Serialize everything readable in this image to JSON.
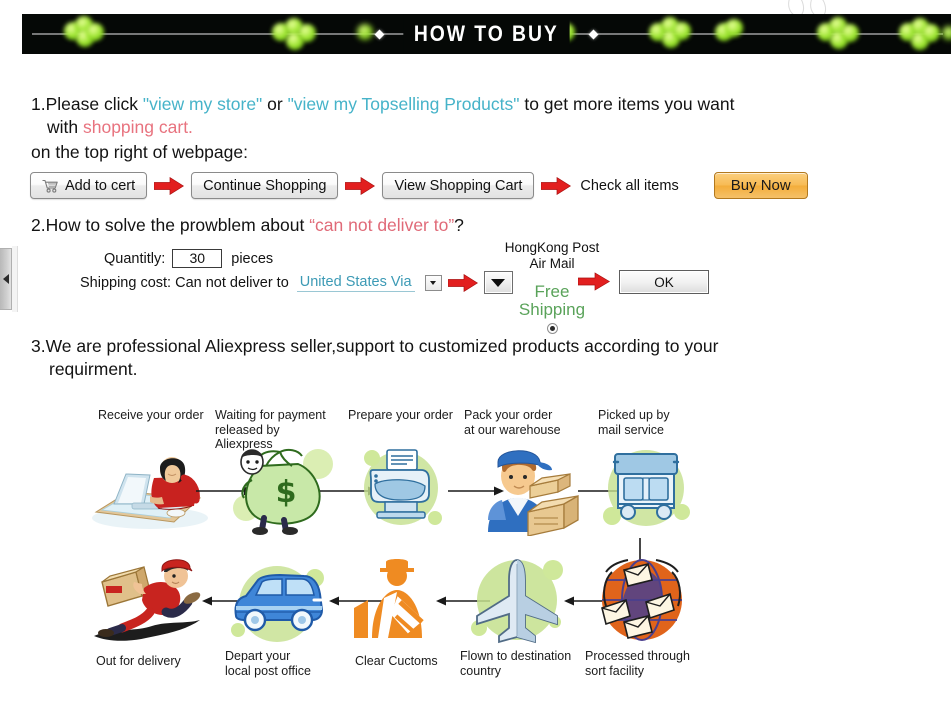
{
  "banner": {
    "title": "HOW TO BUY",
    "bullet_icon": "diamond-bullet",
    "background_color": "#050806",
    "text_color": "#ffffff"
  },
  "watermark": {
    "icon": "faint-watermark-mark"
  },
  "left_tab": {
    "icon": "collapse-left-arrow-icon"
  },
  "section1": {
    "number": "1.",
    "line1_a": "Please click ",
    "link1": "\"view my store\"",
    "line1_b": " or ",
    "link2": "\"view my Topselling Products\"",
    "line1_c": " to get more items you want",
    "line2_a": "with ",
    "line2_highlight": "shopping cart.",
    "line3": "on the top right of webpage:",
    "link_color": "#46b3c9",
    "highlight_color": "#e8737f",
    "buttons": {
      "add_to_cart": "Add to cert",
      "add_to_cart_icon": "shopping-cart-icon",
      "continue_shopping": "Continue Shopping",
      "view_shopping_cart": "View Shopping Cart",
      "check_all_items": "Check all items",
      "buy_now": "Buy Now",
      "buy_now_color": "#f3ad3b",
      "arrow_icon": "red-right-arrow-icon",
      "arrow_color": "#e21f1f"
    }
  },
  "section2": {
    "number": "2.",
    "heading_a": "How to solve the prowblem about ",
    "heading_quote": "“can not deliver to”",
    "heading_b": "?",
    "heading_quote_color": "#e8737f",
    "quantity_label": "Quantitly:",
    "quantity_value": "30",
    "quantity_unit": "pieces",
    "shipping_label": "Shipping cost: Can not deliver to",
    "shipping_value": "United States Via",
    "shipping_value_color": "#3c9ab5",
    "mini_dropdown_icon": "chevron-down-icon",
    "big_dropdown_icon": "chevron-down-icon",
    "arrow_icon": "red-right-arrow-icon",
    "shipping_method_line1": "HongKong Post",
    "shipping_method_line2": "Air Mail",
    "free_shipping_line1": "Free",
    "free_shipping_line2": "Shipping",
    "free_shipping_color": "#5aa35a",
    "radio_icon": "radio-selected-icon",
    "ok_button": "OK"
  },
  "section3": {
    "number": "3.",
    "line1": "We are professional Aliexpress seller,support to customized products according to your",
    "line2": "requirment."
  },
  "flow": {
    "top_row": [
      {
        "label": "Receive your order",
        "icon": "person-at-computer-icon"
      },
      {
        "label": "Waiting for payment\nreleased by Aliexpress",
        "icon": "money-bag-icon"
      },
      {
        "label": "Prepare your order",
        "icon": "printer-icon"
      },
      {
        "label": "Pack your order\nat our warehouse",
        "icon": "worker-with-boxes-icon"
      },
      {
        "label": "Picked up by\nmail service",
        "icon": "delivery-truck-icon"
      }
    ],
    "bottom_row": [
      {
        "label": "Out for delivery",
        "icon": "running-courier-icon"
      },
      {
        "label": "Depart your\nlocal post office",
        "icon": "blue-van-icon"
      },
      {
        "label": "Clear Cuctoms",
        "icon": "customs-officer-icon"
      },
      {
        "label": "Flown to destination\ncountry",
        "icon": "airplane-icon"
      },
      {
        "label": "Processed through\nsort facility",
        "icon": "mail-sorting-globe-icon"
      }
    ],
    "arrow_icon": "black-arrow-icon"
  }
}
